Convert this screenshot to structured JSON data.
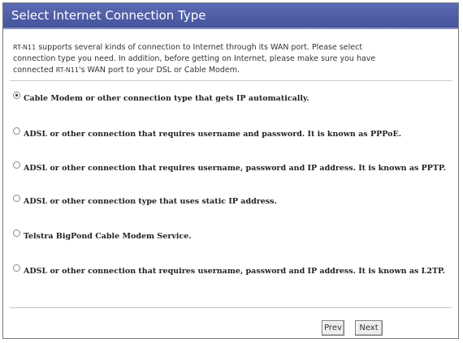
{
  "header": {
    "title": "Select Internet Connection Type"
  },
  "description": {
    "model": "RT-N11",
    "text1": " supports several kinds of connection to Internet through its WAN port. Please select",
    "line2": "connection type you need. In addition, before getting on Internet, please make sure you have",
    "line3_prefix": "connected ",
    "model2": "RT-N11",
    "line3_suffix": "'s WAN port to your DSL or Cable Modem."
  },
  "options": [
    {
      "label": "Cable Modem or other connection type that gets IP automatically.",
      "selected": true
    },
    {
      "label": "ADSL or other connection that requires username and password. It is known as PPPoE.",
      "selected": false
    },
    {
      "label": "ADSL or other connection that requires username, password and IP address. It is known as PPTP.",
      "selected": false
    },
    {
      "label": "ADSL or other connection type that uses static IP address.",
      "selected": false
    },
    {
      "label": "Telstra BigPond Cable Modem Service.",
      "selected": false
    },
    {
      "label": "ADSL or other connection that requires username, password and IP address. It is known as L2TP.",
      "selected": false
    }
  ],
  "buttons": {
    "prev": "Prev",
    "next": "Next"
  }
}
